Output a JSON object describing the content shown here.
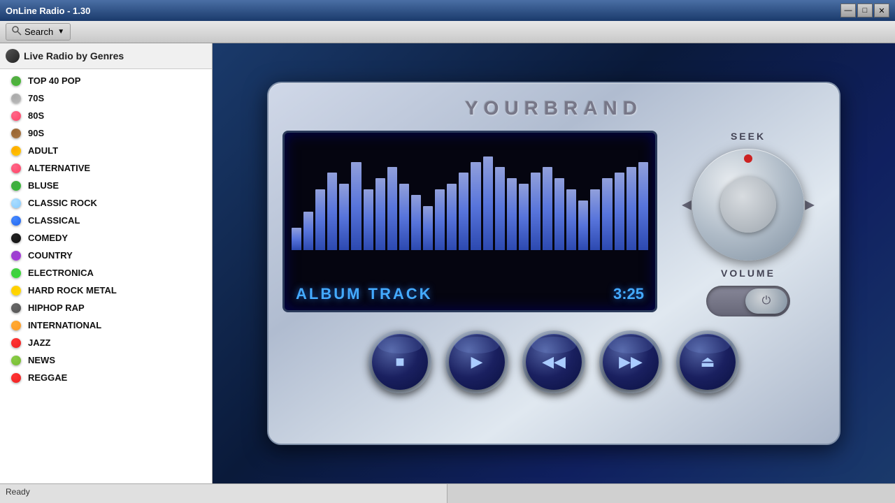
{
  "window": {
    "title": "OnLine Radio - 1.30",
    "min_btn": "—",
    "max_btn": "□",
    "close_btn": "✕"
  },
  "toolbar": {
    "search_label": "Search"
  },
  "sidebar": {
    "header": "Live Radio by Genres",
    "genres": [
      {
        "name": "TOP 40 POP",
        "color": "#55aa44",
        "dot_color": "#44bb33"
      },
      {
        "name": "70S",
        "color": "#aaaaaa",
        "dot_color": "#bbbbbb"
      },
      {
        "name": "80S",
        "color": "#ff6688",
        "dot_color": "#ff4466"
      },
      {
        "name": "90S",
        "color": "#996633",
        "dot_color": "#aa7744"
      },
      {
        "name": "ADULT",
        "color": "#ffaa00",
        "dot_color": "#ffcc00"
      },
      {
        "name": "ALTERNATIVE",
        "color": "#ff6688",
        "dot_color": "#ff4466"
      },
      {
        "name": "BLUSE",
        "color": "#44aa44",
        "dot_color": "#33bb33"
      },
      {
        "name": "CLASSIC ROCK",
        "color": "#aaddff",
        "dot_color": "#88ccff"
      },
      {
        "name": "CLASSICAL",
        "color": "#4488ff",
        "dot_color": "#2266ee"
      },
      {
        "name": "COMEDY",
        "color": "#222222",
        "dot_color": "#111111"
      },
      {
        "name": "COUNTRY",
        "color": "#9944cc",
        "dot_color": "#aa33dd"
      },
      {
        "name": "ELECTRONICA",
        "color": "#44cc44",
        "dot_color": "#33dd33"
      },
      {
        "name": "HARD ROCK METAL",
        "color": "#ffcc00",
        "dot_color": "#ffdd00"
      },
      {
        "name": "HIPHOP RAP",
        "color": "#666666",
        "dot_color": "#555555"
      },
      {
        "name": "INTERNATIONAL",
        "color": "#ffaa33",
        "dot_color": "#ff9922"
      },
      {
        "name": "JAZZ",
        "color": "#ff3333",
        "dot_color": "#ee2222"
      },
      {
        "name": "NEWS",
        "color": "#88cc44",
        "dot_color": "#77bb33"
      },
      {
        "name": "REGGAE",
        "color": "#ff3333",
        "dot_color": "#ee2222"
      }
    ]
  },
  "player": {
    "brand": "YOURBRAND",
    "seek_label": "SEEK",
    "volume_label": "VOLUME",
    "track_name": "ALBUM TRACK",
    "track_time": "3:25",
    "eq_bars": [
      20,
      35,
      55,
      70,
      60,
      80,
      55,
      65,
      75,
      60,
      50,
      40,
      55,
      60,
      70,
      80,
      85,
      75,
      65,
      60,
      70,
      75,
      65,
      55,
      45,
      55,
      65,
      70,
      75,
      80
    ],
    "controls": {
      "stop": "■",
      "play": "▶",
      "prev": "◀◀",
      "next": "▶▶",
      "eject": "⏏"
    }
  },
  "statusbar": {
    "left": "Ready",
    "right": ""
  }
}
